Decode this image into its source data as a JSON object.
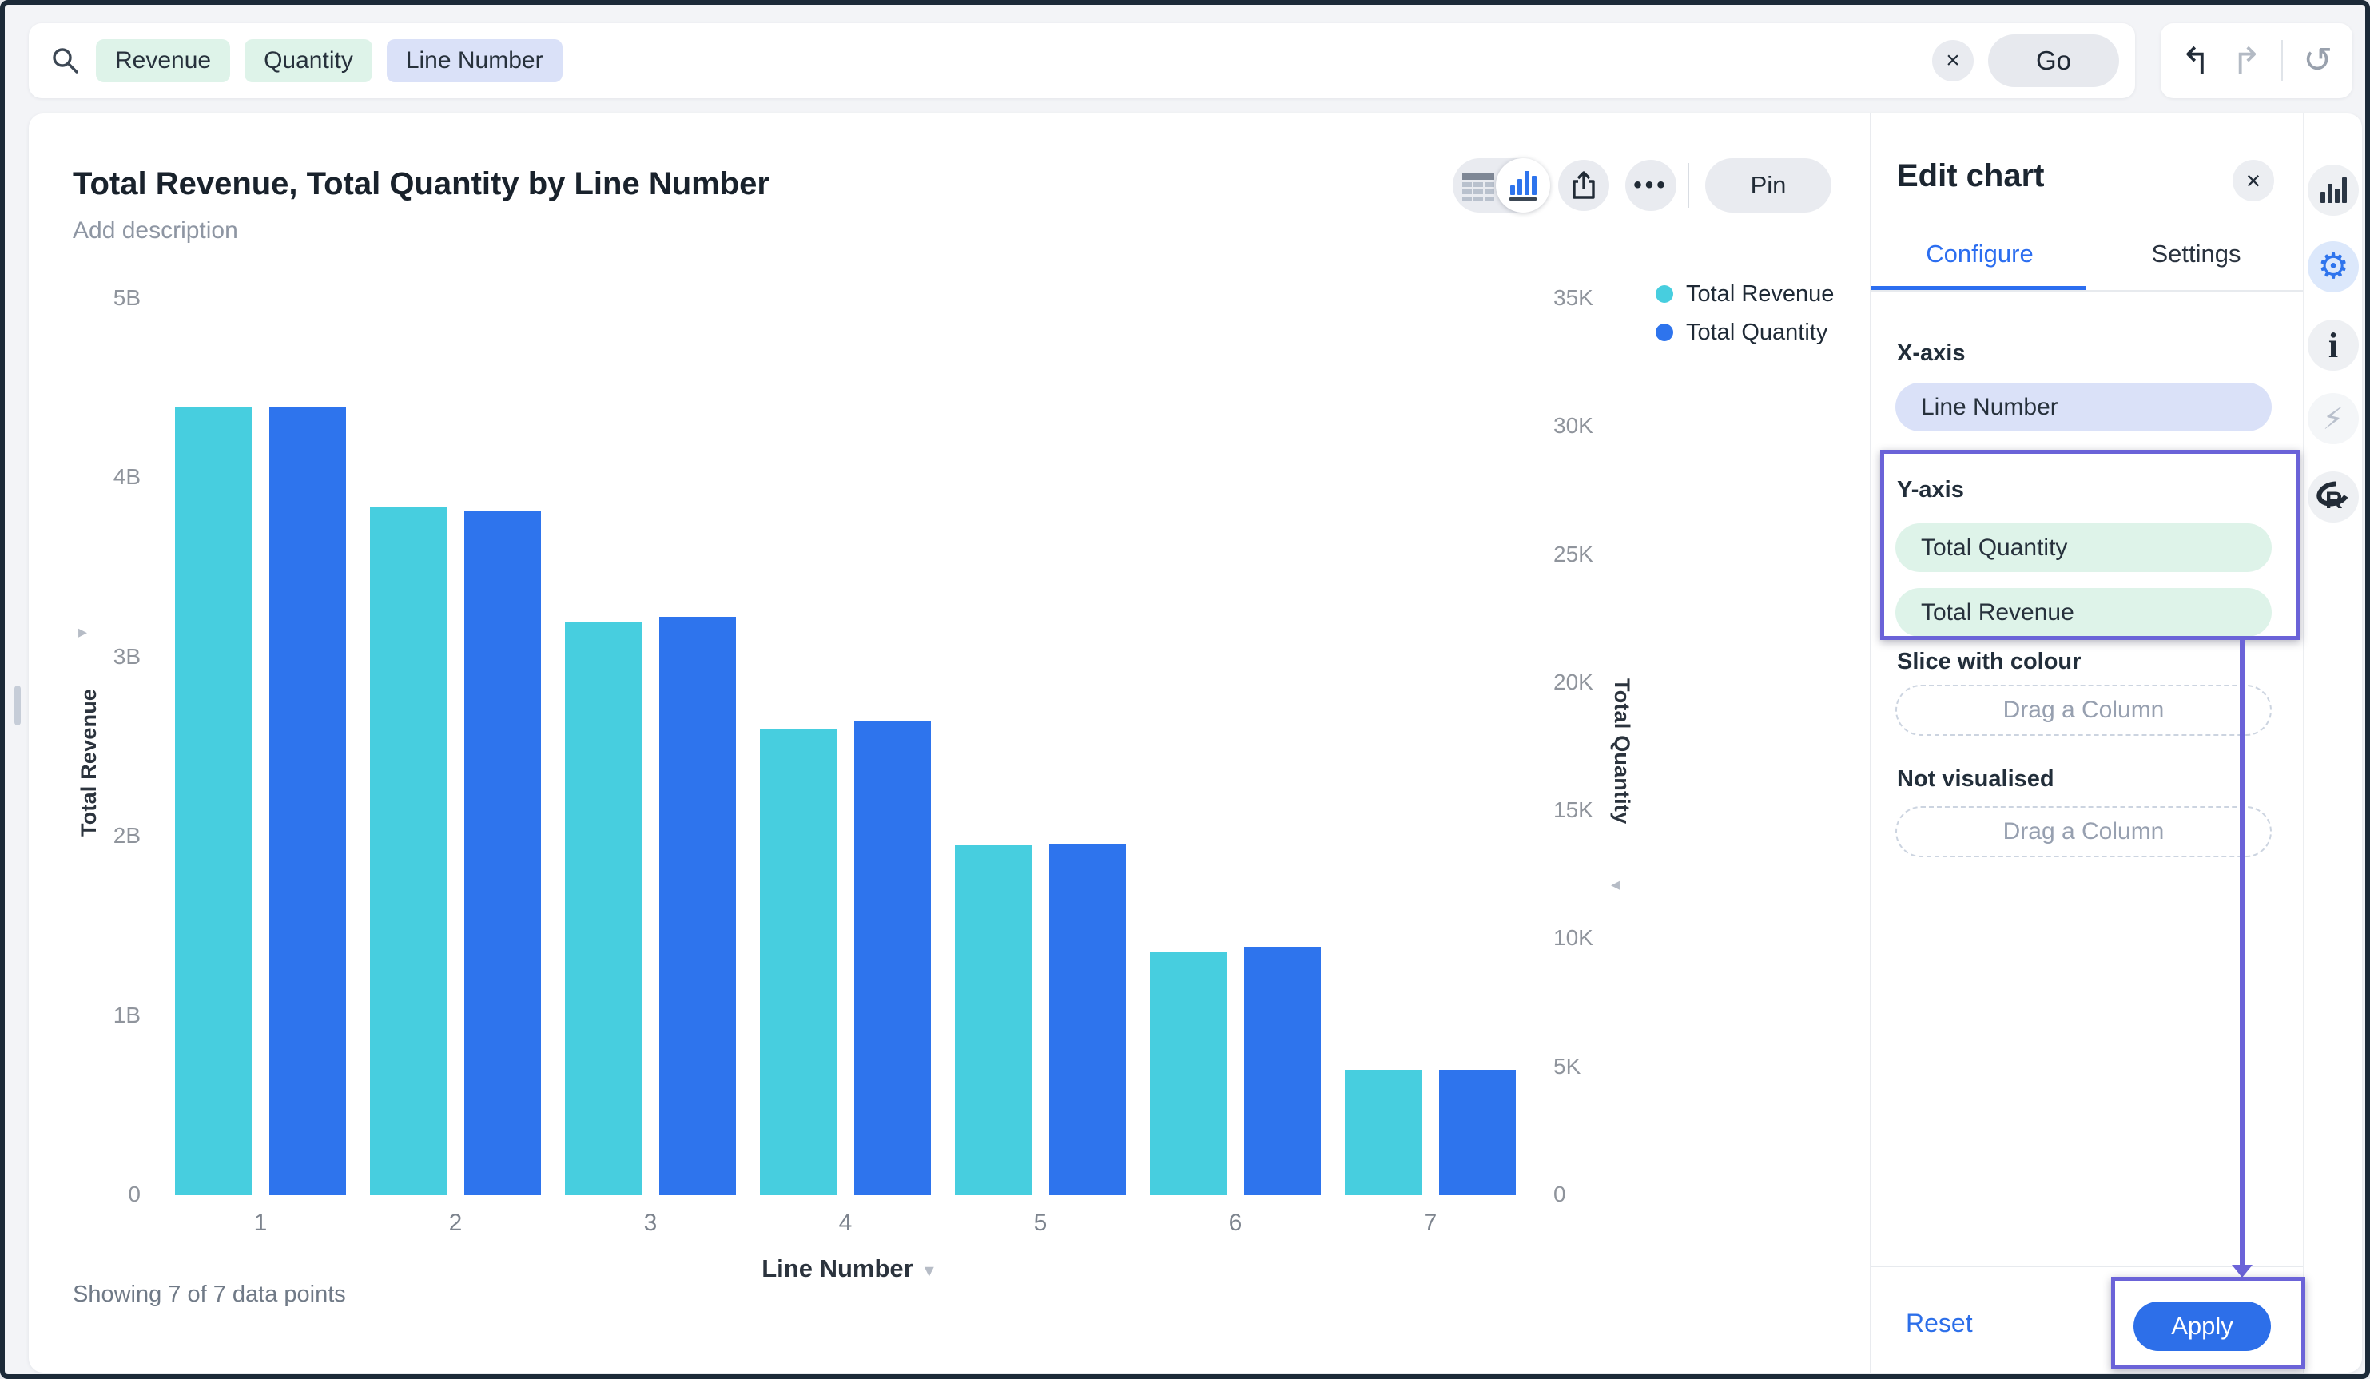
{
  "colors": {
    "accent_blue": "#2d6fe9",
    "revenue_cyan": "#47CEDF",
    "quantity_blue": "#2E74ED",
    "annotation_purple": "#6b63d8",
    "chip_measure_bg": "#def3e9",
    "chip_attribute_bg": "#dae1f8"
  },
  "search": {
    "tokens": [
      {
        "label": "Revenue",
        "kind": "measure"
      },
      {
        "label": "Quantity",
        "kind": "measure"
      },
      {
        "label": "Line Number",
        "kind": "attribute"
      }
    ],
    "clear_glyph": "×",
    "go_label": "Go"
  },
  "top_actions": {
    "undo_glyph": "↰",
    "redo_glyph": "↱",
    "refresh_glyph": "↺"
  },
  "viz": {
    "title": "Total Revenue, Total Quantity by Line Number",
    "description_placeholder": "Add description",
    "pin_label": "Pin",
    "more_glyph": "•••",
    "footer_note": "Showing 7 of 7 data points",
    "legend": [
      {
        "label": "Total Revenue",
        "color": "#47CEDF"
      },
      {
        "label": "Total Quantity",
        "color": "#2E74ED"
      }
    ]
  },
  "chart_data": {
    "type": "bar",
    "dual_axis": true,
    "title": "Total Revenue, Total Quantity by Line Number",
    "categories": [
      "1",
      "2",
      "3",
      "4",
      "5",
      "6",
      "7"
    ],
    "series": [
      {
        "name": "Total Revenue",
        "axis": "left",
        "color": "#47CEDF",
        "unit": "billions",
        "values": [
          4.4,
          3.84,
          3.2,
          2.6,
          1.95,
          1.36,
          0.7
        ]
      },
      {
        "name": "Total Quantity",
        "axis": "right",
        "color": "#2E74ED",
        "unit": "thousands",
        "values": [
          30.8,
          26.7,
          22.6,
          18.5,
          13.7,
          9.7,
          4.9
        ]
      }
    ],
    "y_left": {
      "title": "Total Revenue",
      "min": 0,
      "max": 5,
      "tick_labels": [
        "5B",
        "4B",
        "3B",
        "2B",
        "1B",
        "0"
      ]
    },
    "y_right": {
      "title": "Total Quantity",
      "min": 0,
      "max": 35,
      "tick_labels": [
        "35K",
        "30K",
        "25K",
        "20K",
        "15K",
        "10K",
        "5K",
        "0"
      ]
    },
    "xlabel": "Line Number",
    "grid": false,
    "legend_position": "top-right"
  },
  "axis_arrows": {
    "left": "▸",
    "right": "◂",
    "x_chevron": "▾"
  },
  "panel": {
    "title": "Edit chart",
    "close_glyph": "×",
    "tabs": [
      {
        "label": "Configure"
      },
      {
        "label": "Settings"
      }
    ],
    "active_tab": "Configure",
    "xaxis_label": "X-axis",
    "xaxis_chip": "Line Number",
    "yaxis_label": "Y-axis",
    "yaxis_chips": [
      "Total Quantity",
      "Total Revenue"
    ],
    "slice_label": "Slice with colour",
    "slice_placeholder": "Drag a Column",
    "notvis_label": "Not visualised",
    "notvis_placeholder": "Drag a Column",
    "reset_label": "Reset",
    "apply_label": "Apply"
  },
  "right_rail": {
    "items": [
      {
        "name": "chart-type-icon",
        "active": false
      },
      {
        "name": "chart-settings-gear-icon",
        "active": true
      },
      {
        "name": "info-icon",
        "active": false
      },
      {
        "name": "insights-bolt-icon",
        "active": false
      },
      {
        "name": "r-analysis-icon",
        "active": false
      }
    ],
    "gear_glyph": "⚙",
    "info_glyph": "i",
    "bolt_glyph": "⚡"
  }
}
